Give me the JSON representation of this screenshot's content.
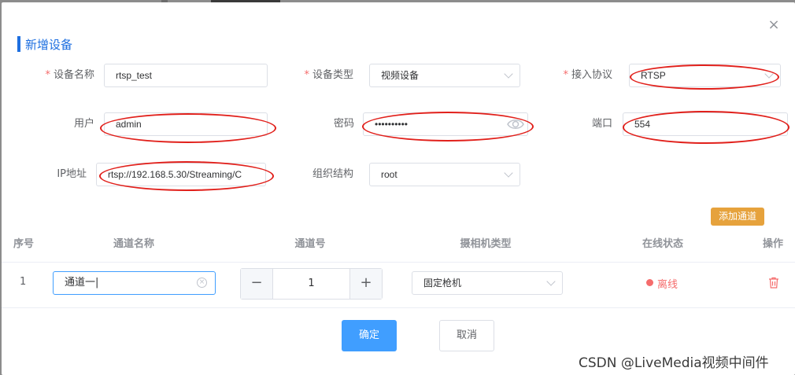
{
  "dialog": {
    "title": "新增设备",
    "close_symbol": "×"
  },
  "form": {
    "device_name": {
      "label": "设备名称",
      "required": "*",
      "value": "rtsp_test"
    },
    "device_type": {
      "label": "设备类型",
      "required": "*",
      "value": "视频设备"
    },
    "protocol": {
      "label": "接入协议",
      "required": "*",
      "value": "RTSP"
    },
    "user": {
      "label": "用户",
      "value": "admin"
    },
    "password": {
      "label": "密码",
      "value": "••••••••••"
    },
    "port": {
      "label": "端口",
      "value": "554"
    },
    "ip": {
      "label": "IP地址",
      "value": "rtsp://192.168.5.30/Streaming/C"
    },
    "org": {
      "label": "组织结构",
      "value": "root"
    }
  },
  "channels": {
    "add_button": "添加通道",
    "headers": [
      "序号",
      "通道名称",
      "通道号",
      "摄相机类型",
      "在线状态",
      "操作"
    ],
    "rows": [
      {
        "index": "1",
        "name": "通道一|",
        "clear_symbol": "×",
        "number": "1",
        "camera_type": "固定枪机",
        "status": "离线",
        "minus": "−",
        "plus": "+"
      }
    ]
  },
  "footer": {
    "confirm": "确定",
    "cancel": "取消"
  },
  "watermark": "CSDN @LiveMedia视频中间件",
  "colors": {
    "primary": "#409eff",
    "title": "#1e6fe0",
    "warning": "#e6a23c",
    "danger": "#f56c6c",
    "annotation": "#e1201b"
  },
  "icons": [
    "close-icon",
    "chevron-down-icon",
    "eye-icon",
    "clear-icon",
    "trash-icon"
  ]
}
